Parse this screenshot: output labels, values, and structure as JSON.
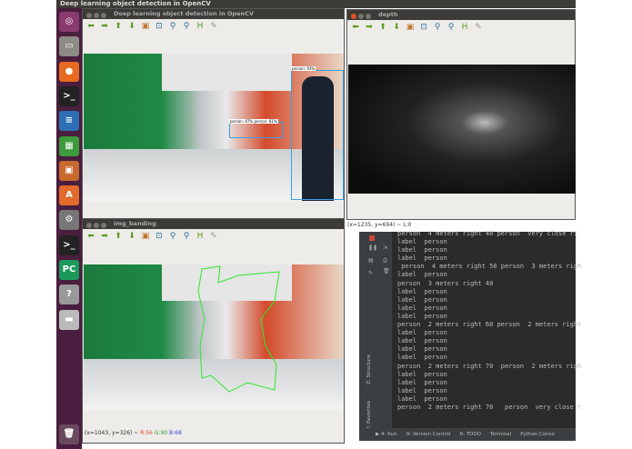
{
  "topbar": {
    "title": "Deep learning object detection in OpenCV"
  },
  "launcher": [
    {
      "name": "ubuntu-dash-icon",
      "glyph": "◎",
      "color": "#8a3a6e"
    },
    {
      "name": "files-icon",
      "glyph": "▭",
      "color": "#8d8b86"
    },
    {
      "name": "firefox-icon",
      "glyph": "●",
      "color": "#e66a1f"
    },
    {
      "name": "terminal-icon",
      "glyph": ">_",
      "color": "#222"
    },
    {
      "name": "writer-icon",
      "glyph": "≡",
      "color": "#2c6fb5"
    },
    {
      "name": "calc-icon",
      "glyph": "▦",
      "color": "#3c9b3c"
    },
    {
      "name": "impress-icon",
      "glyph": "▣",
      "color": "#c86a2f"
    },
    {
      "name": "software-center-icon",
      "glyph": "A",
      "color": "#e26a2a"
    },
    {
      "name": "settings-icon",
      "glyph": "⚙",
      "color": "#777"
    },
    {
      "name": "terminal2-icon",
      "glyph": ">_",
      "color": "#222"
    },
    {
      "name": "pycharm-icon",
      "glyph": "PC",
      "color": "#1a9a5a"
    },
    {
      "name": "help-icon",
      "glyph": "?",
      "color": "#999"
    },
    {
      "name": "drive-icon",
      "glyph": "▬",
      "color": "#bbb"
    }
  ],
  "trash": {
    "name": "trash-icon",
    "glyph": "🗑"
  },
  "toolbar": [
    "⬅",
    "➡",
    "⬆",
    "⬇",
    "▣",
    "⊡",
    "⚲",
    "⚲",
    "H",
    "✎"
  ],
  "win_detect": {
    "title": "Deep learning object detection in OpenCV",
    "labels": [
      "person: 93%",
      "person: 87%  person: 81%"
    ]
  },
  "win_depth": {
    "title": "depth",
    "status": "(x=1235, y=694) ~ L:0"
  },
  "win_banding": {
    "title": "img_banding",
    "status_xy": "(x=1043, y=326) ~",
    "r": "R:56",
    "g": "G:90",
    "b": "B:68"
  },
  "console": {
    "lines": [
      "person  4 meters right 40 person  very close ri",
      "label  person",
      "label  person",
      "label  person",
      " person  4 meters right 50 person  3 meters righ",
      "label  person",
      "person  3 meters right 40",
      "label  person",
      "label  person",
      "label  person",
      "label  person",
      "person  2 meters right 60 person  2 meters right",
      "label  person",
      "label  person",
      "label  person",
      "label  person",
      "person  2 meters right 70  person  2 meters righ",
      "label  person",
      "label  person",
      "label  person",
      "label  person",
      "person  2 meters right 70   person  very close r"
    ]
  },
  "ide": {
    "side_tabs": [
      "Z: Structure",
      "2: Favorites"
    ],
    "bottom_tabs": [
      "▶ 4: Run",
      "9: Version Control",
      "6: TODO",
      "Terminal",
      "Python Conso"
    ]
  }
}
